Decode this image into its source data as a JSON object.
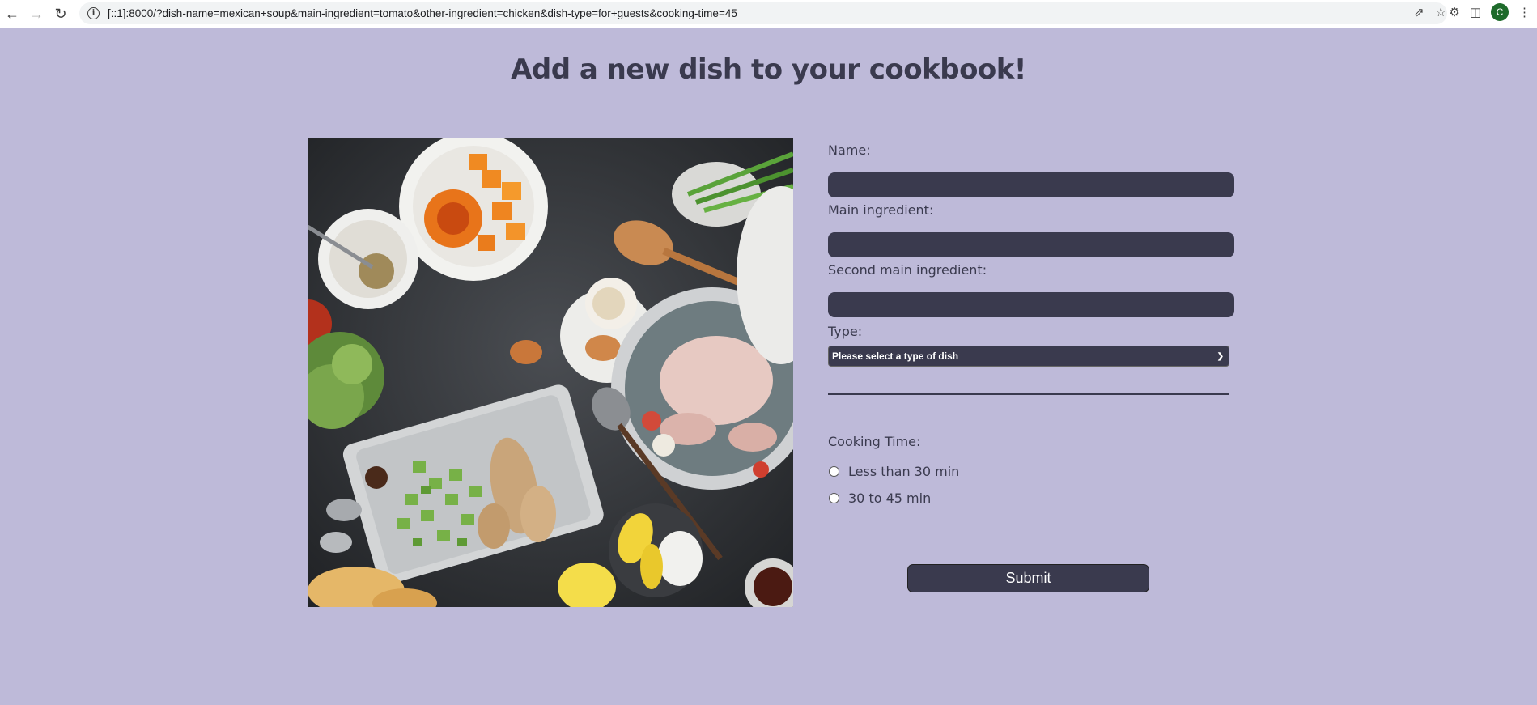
{
  "browser": {
    "url": "[::1]:8000/?dish-name=mexican+soup&main-ingredient=tomato&other-ingredient=chicken&dish-type=for+guests&cooking-time=45",
    "profile_initial": "C"
  },
  "page": {
    "title": "Add a new dish to your cookbook!"
  },
  "form": {
    "name_label": "Name:",
    "name_value": "",
    "main_ingredient_label": "Main ingredient:",
    "main_ingredient_value": "",
    "second_ingredient_label": "Second main ingredient:",
    "second_ingredient_value": "",
    "type_label": "Type:",
    "type_selected": "Please select a type of dish",
    "cooking_time_label": "Cooking Time:",
    "cooking_options": [
      "Less than 30 min",
      "30 to 45 min"
    ],
    "submit_label": "Submit"
  },
  "colors": {
    "background": "#bebad9",
    "accent": "#3a3a4e"
  }
}
